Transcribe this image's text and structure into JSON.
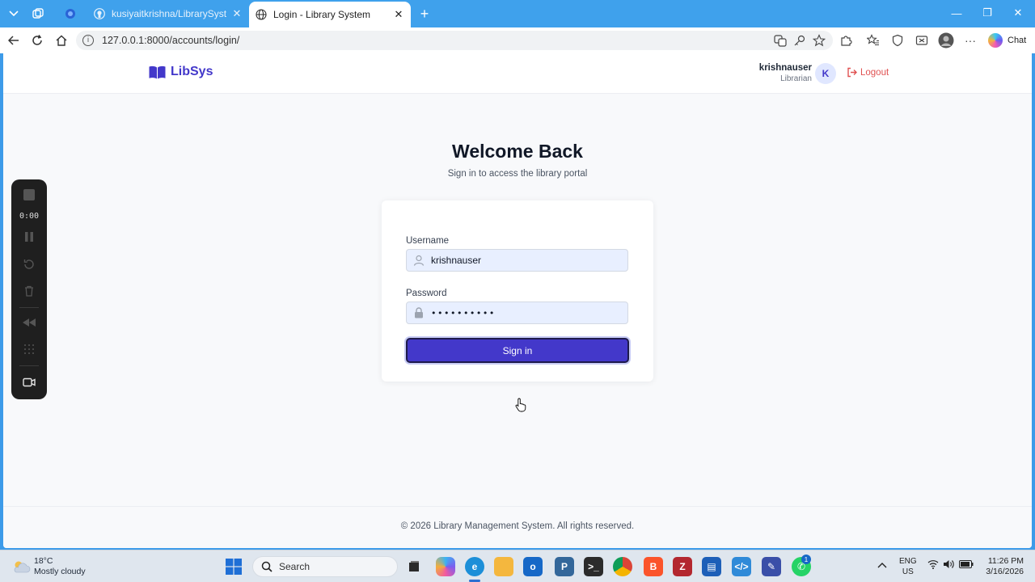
{
  "browser": {
    "tabs": [
      {
        "title": "",
        "kind": "copilot-icon"
      },
      {
        "title": "kusiyaitkrishna/LibrarySystem: A C",
        "kind": "github-icon",
        "active": false
      },
      {
        "title": "Login - Library System",
        "kind": "globe-icon",
        "active": true
      }
    ],
    "new_tab": "+",
    "url": "127.0.0.1:8000/accounts/login/",
    "chat_label": "Chat"
  },
  "header": {
    "brand": "LibSys",
    "username": "krishnauser",
    "role": "Librarian",
    "avatar_letter": "K",
    "logout": "Logout"
  },
  "login": {
    "title": "Welcome Back",
    "subtitle": "Sign in to access the library portal",
    "username_label": "Username",
    "username_value": "krishnauser",
    "password_label": "Password",
    "password_value": "••••••••••",
    "submit": "Sign in"
  },
  "footer": {
    "text": "© 2026 Library Management System. All rights reserved."
  },
  "recorder": {
    "timer": "0:00"
  },
  "taskbar": {
    "weather_temp": "18°C",
    "weather_desc": "Mostly cloudy",
    "search_placeholder": "Search",
    "lang_line1": "ENG",
    "lang_line2": "US",
    "time": "11:26 PM",
    "date": "3/16/2026",
    "whatsapp_badge": "1"
  },
  "colors": {
    "accent": "#4338ca",
    "logout": "#e05252",
    "field_bg": "#e8efff",
    "tabbar": "#3fa1ec"
  }
}
